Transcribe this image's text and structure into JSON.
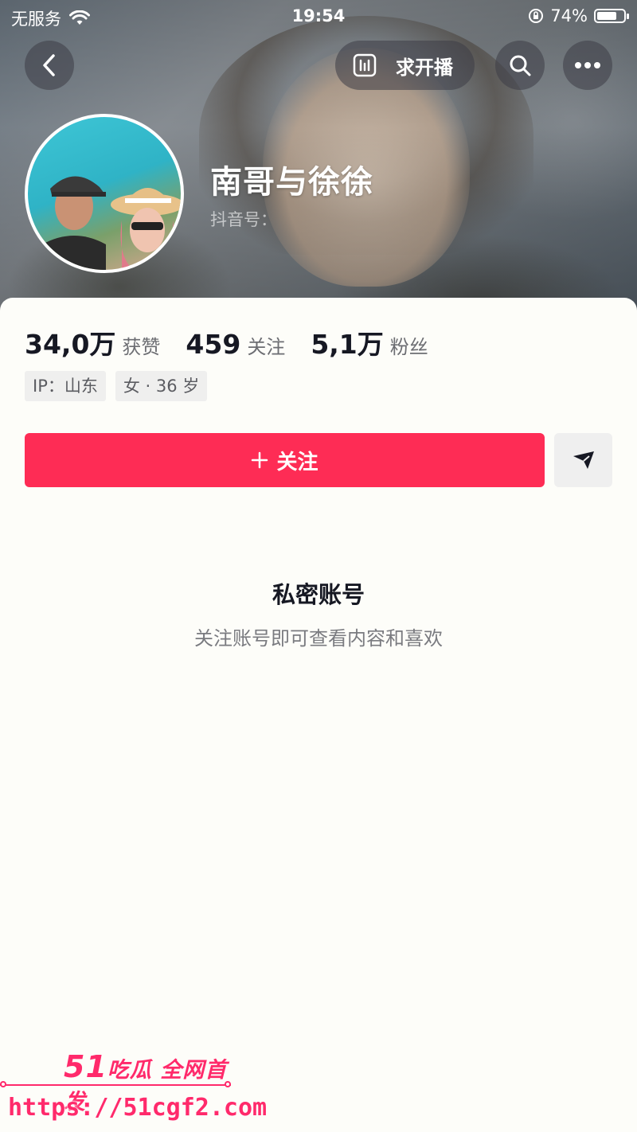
{
  "status_bar": {
    "carrier": "无服务",
    "time": "19:54",
    "battery": "74%",
    "battery_level": 0.74
  },
  "nav": {
    "request_live_label": "求开播"
  },
  "profile": {
    "name": "南哥与徐徐",
    "douyin_id_label": "抖音号："
  },
  "stats": [
    {
      "value": "34,0万",
      "label": "获赞"
    },
    {
      "value": "459",
      "label": "关注"
    },
    {
      "value": "5,1万",
      "label": "粉丝"
    }
  ],
  "tags": [
    "IP：山东",
    "女 · 36 岁"
  ],
  "follow_button": {
    "label": "关注",
    "icon": "plus-icon"
  },
  "private_notice": {
    "title": "私密账号",
    "subtitle": "关注账号即可查看内容和喜欢"
  },
  "watermark": {
    "brand_number": "51",
    "brand_text": "吃瓜 全网首发",
    "url": "https://51cgf2.com"
  },
  "colors": {
    "accent": "#fe2c55",
    "watermark": "#ff2a6b"
  }
}
